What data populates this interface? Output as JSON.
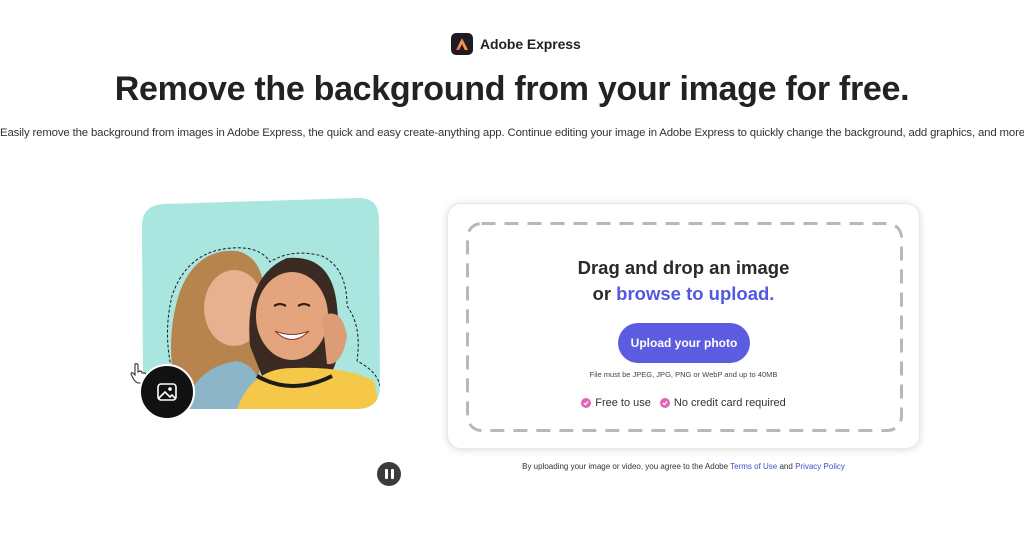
{
  "header": {
    "brand_name": "Adobe Express",
    "logo_icon": "adobe-express-logo"
  },
  "main": {
    "headline": "Remove the background from your image for free.",
    "subtext": "Easily remove the background from images in Adobe Express, the quick and easy create-anything app. Continue editing your image in Adobe Express to quickly change the background, add graphics, and more."
  },
  "hero": {
    "background_color": "#a9e6e0",
    "toggle_icon": "image-icon",
    "pause_icon": "pause-icon"
  },
  "uploader": {
    "title_line1": "Drag and drop an image",
    "title_or": "or",
    "browse_link": "browse to upload.",
    "upload_button": "Upload your photo",
    "file_note": "File must be JPEG, JPG, PNG or WebP and up to 40MB",
    "perk1": "Free to use",
    "perk2": "No credit card required",
    "accent_color": "#5c5ce0"
  },
  "legal": {
    "prefix": "By uploading your image or video, you agree to the Adobe",
    "terms": "Terms of Use",
    "and": "and",
    "privacy": "Privacy Policy"
  }
}
